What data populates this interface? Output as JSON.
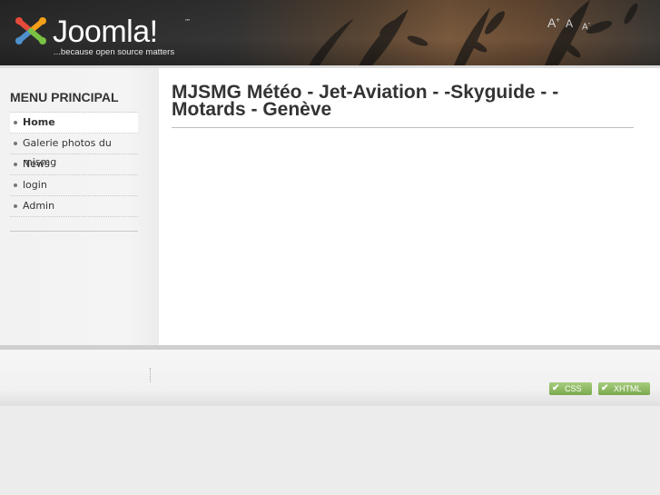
{
  "header": {
    "logo": {
      "text": "Joomla!",
      "trademark": "™",
      "tagline": "...because open source matters",
      "icon": "joomla-logo-icon"
    },
    "font_controls": {
      "larger": "A",
      "larger_sign": "+",
      "reset": "A",
      "smaller": "A",
      "smaller_sign": "-"
    }
  },
  "sidebar": {
    "title": "MENU PRINCIPAL",
    "items": [
      {
        "label": "Home",
        "active": true
      },
      {
        "label": "Galerie photos du mjsmg",
        "active": false
      },
      {
        "label": "News",
        "active": false
      },
      {
        "label": "login",
        "active": false
      },
      {
        "label": "Admin",
        "active": false
      }
    ]
  },
  "main": {
    "title": "MJSMG Météo - Jet-Aviation - -Skyguide - - Motards - Genève"
  },
  "footer": {
    "badges": [
      {
        "label": "CSS",
        "icon": "check-icon"
      },
      {
        "label": "XHTML",
        "icon": "check-icon"
      }
    ]
  },
  "colors": {
    "accent": "#7aa94e",
    "text": "#333333",
    "sidebar_bg": "#f2f2f2"
  }
}
